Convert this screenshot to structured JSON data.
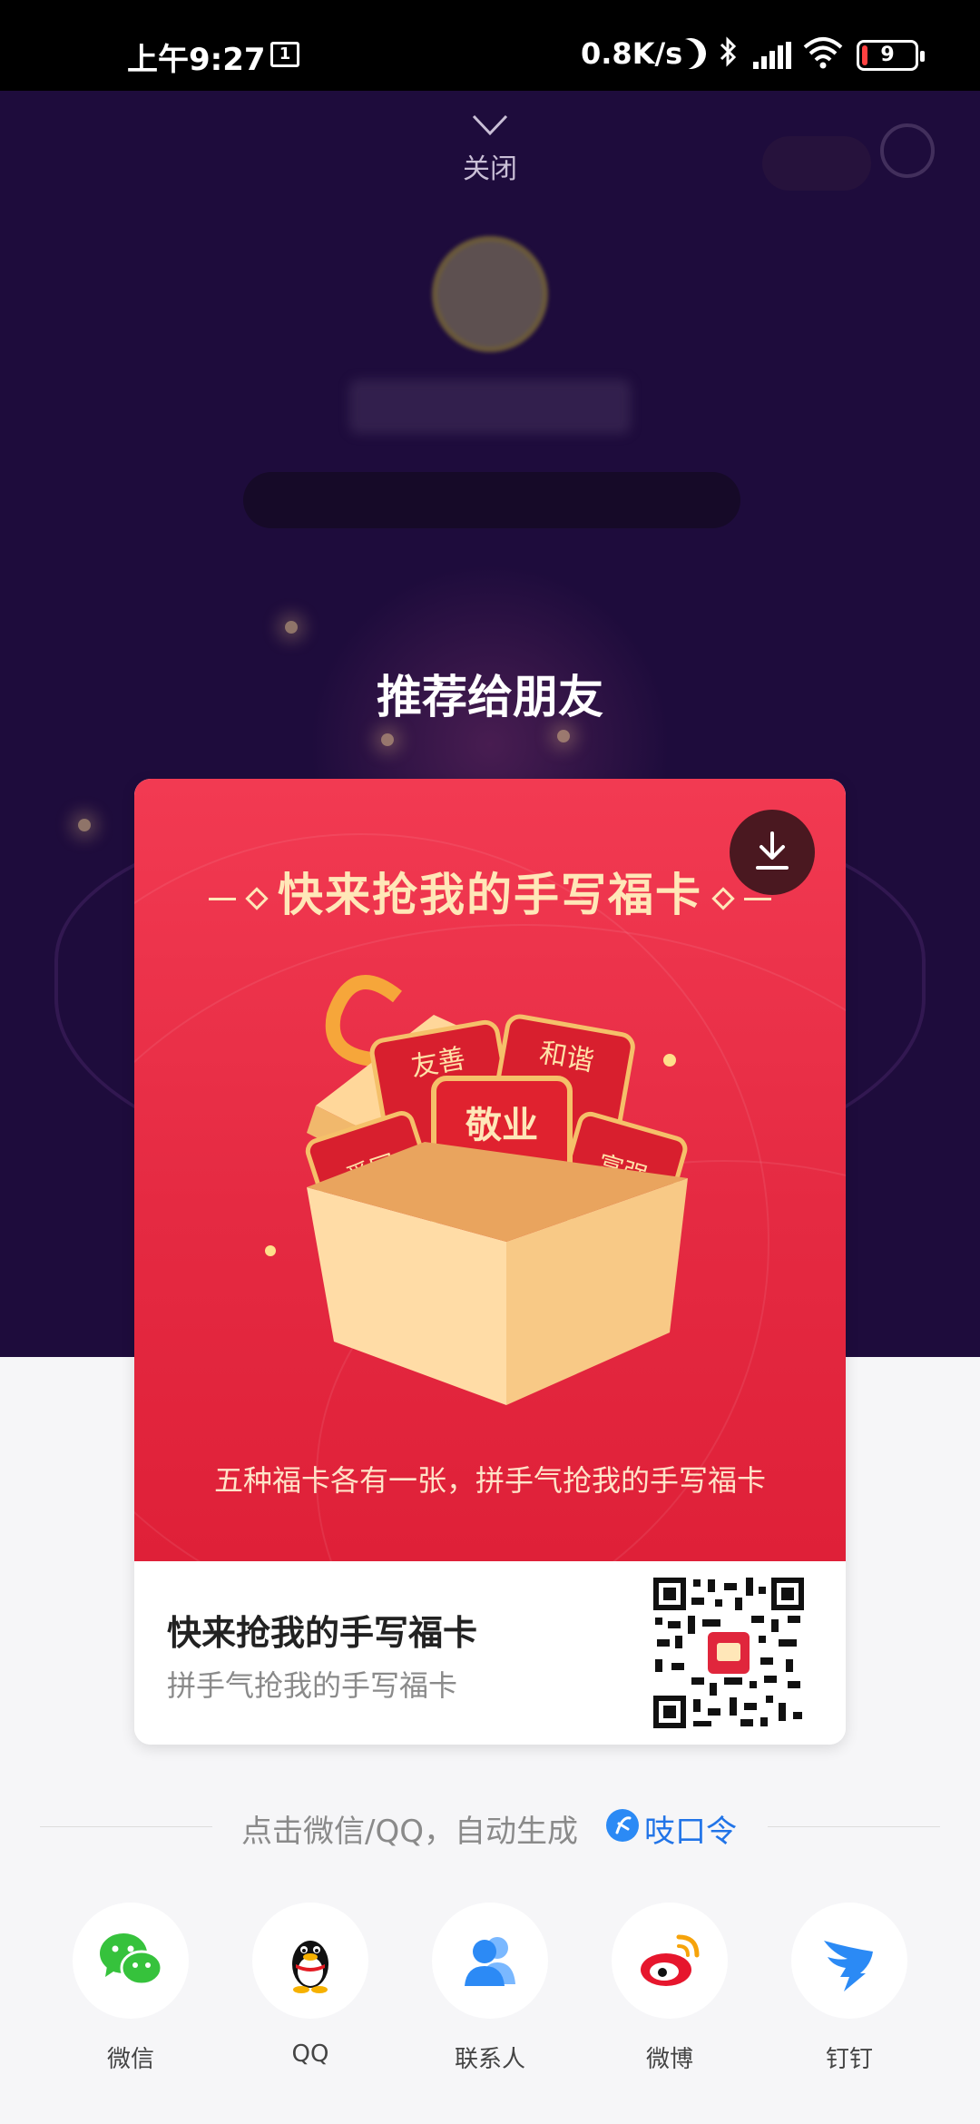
{
  "status_bar": {
    "time": "上午9:27",
    "sim": "1",
    "network_speed": "0.8K/s",
    "battery": "9"
  },
  "background": {
    "close_label": "关闭"
  },
  "share_sheet": {
    "title": "推荐给朋友",
    "card": {
      "headline": "快来抢我的手写福卡",
      "caption": "五种福卡各有一张，拼手气抢我的手写福卡",
      "gift_card_words": [
        "友善",
        "和谐",
        "爱国",
        "敬业",
        "富强"
      ],
      "footer_title": "快来抢我的手写福卡",
      "footer_subtitle": "拼手气抢我的手写福卡"
    },
    "hint_text": "点击微信/QQ，自动生成",
    "hint_link": "吱口令",
    "targets": [
      {
        "label": "微信",
        "icon": "wechat-icon"
      },
      {
        "label": "QQ",
        "icon": "qq-icon"
      },
      {
        "label": "联系人",
        "icon": "contacts-icon"
      },
      {
        "label": "微博",
        "icon": "weibo-icon"
      },
      {
        "label": "钉钉",
        "icon": "dingtalk-icon"
      }
    ]
  },
  "colors": {
    "poster_red": "#e52a42",
    "headline_gold": "#ffe7b8",
    "link_blue": "#2174e8",
    "overlay_purple": "#1e0c3c"
  }
}
